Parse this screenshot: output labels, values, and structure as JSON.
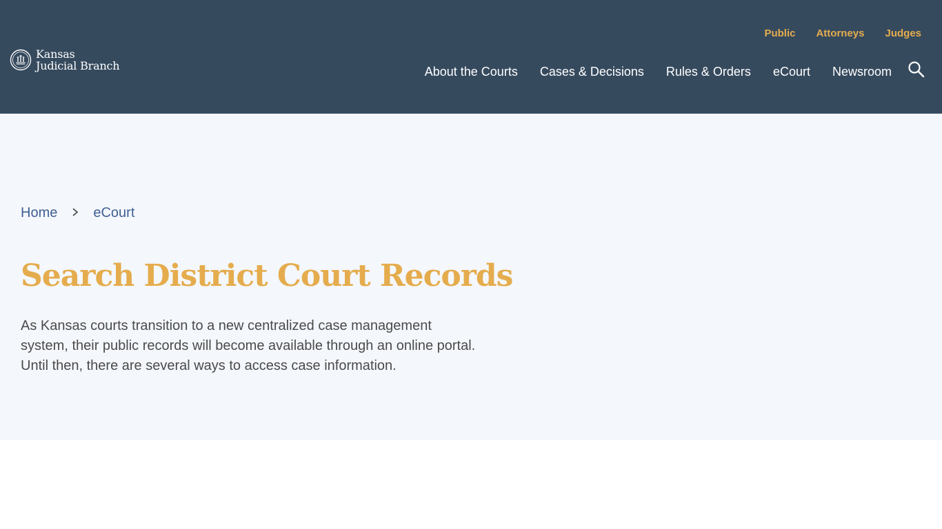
{
  "site": {
    "name_line1": "Kansas",
    "name_line2": "Judicial Branch",
    "logo_icon": "kansas-seal-icon"
  },
  "utility_nav": [
    {
      "label": "Public"
    },
    {
      "label": "Attorneys"
    },
    {
      "label": "Judges"
    }
  ],
  "main_nav": [
    {
      "label": "About the Courts"
    },
    {
      "label": "Cases & Decisions"
    },
    {
      "label": "Rules & Orders"
    },
    {
      "label": "eCourt"
    },
    {
      "label": "Newsroom"
    }
  ],
  "search": {
    "icon": "search-icon"
  },
  "breadcrumb": {
    "home": "Home",
    "separator_icon": "chevron-right-icon",
    "current": "eCourt"
  },
  "page": {
    "title": "Search District Court Records",
    "intro": "As Kansas courts transition to a new centralized case management system, their public records will become available through an online portal. Until then, there are several ways to access case information."
  },
  "colors": {
    "header_bg": "#364a5e",
    "accent_gold": "#e5ac4d",
    "hero_bg": "#f4f7fc",
    "link_blue": "#3f5f94",
    "body_text": "#4a4a4a"
  }
}
